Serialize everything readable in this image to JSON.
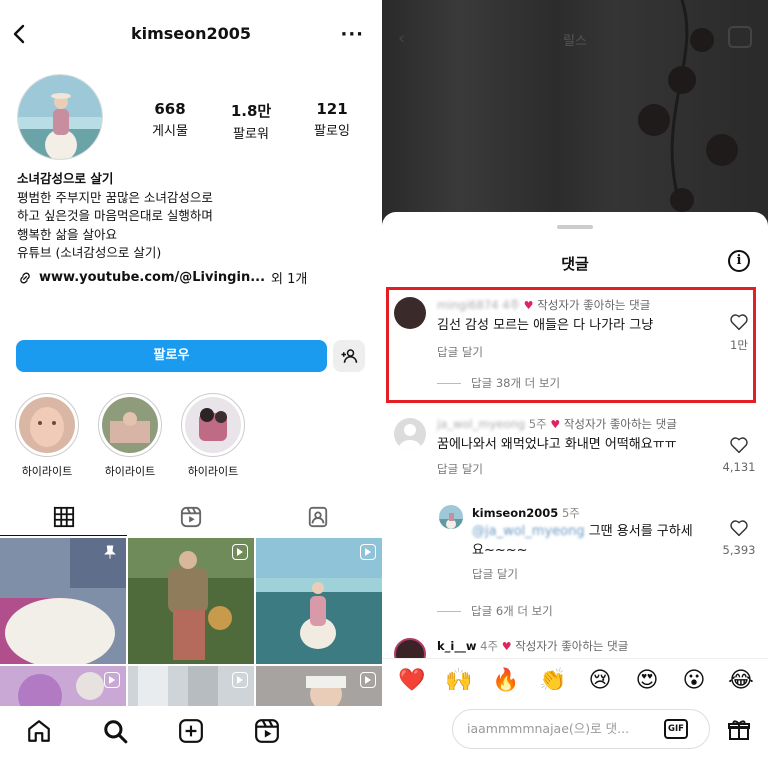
{
  "profile": {
    "username": "kimseon2005",
    "stats": [
      {
        "num": "668",
        "label": "게시물"
      },
      {
        "num": "1.8만",
        "label": "팔로워"
      },
      {
        "num": "121",
        "label": "팔로잉"
      }
    ],
    "bio_name": "소녀감성으로  살기",
    "bio_lines": [
      "평범한 주부지만 꿈많은 소녀감성으로",
      "하고 싶은것을 마음먹은대로 실행하며",
      "행복한 삶을 살아요",
      "유튜브 (소녀감성으로 살기)"
    ],
    "link_text": "www.youtube.com/@Livingin...",
    "link_more": "외 1개",
    "follow_label": "팔로우",
    "highlights": [
      "하이라이트",
      "하이라이트",
      "하이라이트"
    ]
  },
  "reel": {
    "title": "릴스"
  },
  "comments_sheet": {
    "title": "댓글",
    "liked_by_author": "작성자가 좋아하는 댓글",
    "comments": [
      {
        "user": "mingi6874",
        "time": "4주",
        "text": "김선 감성 모르는 애들은 다 나가라 그냥",
        "reply": "답글 달기",
        "likes": "1만",
        "view_replies": "답글 38개 더 보기"
      },
      {
        "user": "ja_wol_myeong",
        "time": "5주",
        "text": "꿈에나와서 왜먹었냐고 화내면 어떡해요ㅠㅠ",
        "reply": "답글 달기",
        "likes": "4,131"
      },
      {
        "user": "kimseon2005",
        "time": "5주",
        "mention": "@ja_wol_myeong",
        "text_a": "그땐 용서를 구하세",
        "text_b": "요~~~~",
        "reply": "답글 달기",
        "likes": "5,393",
        "view_replies": "답글 6개 더 보기"
      },
      {
        "user": "k_i__w",
        "time": "4주"
      }
    ],
    "emojis": [
      "❤️",
      "🙌",
      "🔥",
      "👏",
      "😢",
      "😍",
      "😮",
      "😂"
    ],
    "input_placeholder": "iaammmmnajae(으)로 댓...",
    "gif_label": "GIF"
  },
  "colors": {
    "follow_blue": "#1a9bf0",
    "highlight_red": "#e31e24",
    "heart_red": "#e0245e"
  }
}
